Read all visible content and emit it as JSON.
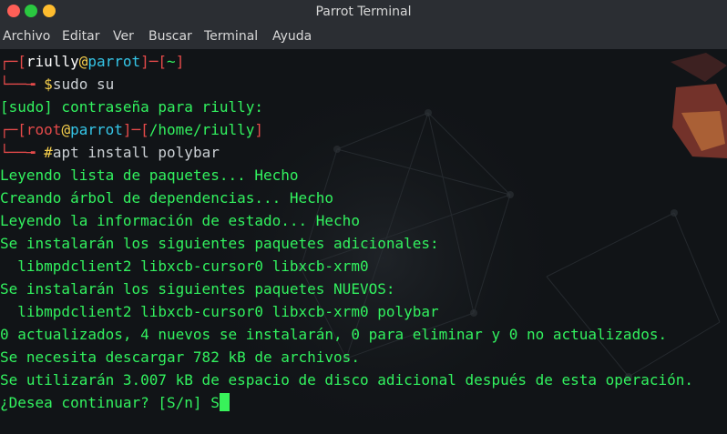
{
  "window": {
    "title": "Parrot Terminal"
  },
  "menu": [
    "Archivo",
    "Editar",
    "Ver",
    "Buscar",
    "Terminal",
    "Ayuda"
  ],
  "terminal": {
    "prompt1": {
      "box_open": "┌─[",
      "user": "riully",
      "at": "@",
      "host": "parrot",
      "sep": "]─[",
      "path": "~",
      "box_close": "]",
      "cmd_prefix": "└──╼ ",
      "dollar": "$",
      "command": "sudo su"
    },
    "sudo_prompt": "[sudo] contraseña para riully:",
    "prompt2": {
      "box_open": "┌─[",
      "user": "root",
      "at": "@",
      "host": "parrot",
      "sep": "]─[",
      "path": "/home/riully",
      "box_close": "]",
      "cmd_prefix": "└──╼ ",
      "hash": "#",
      "command": "apt install polybar"
    },
    "output": [
      "Leyendo lista de paquetes... Hecho",
      "Creando árbol de dependencias... Hecho",
      "Leyendo la información de estado... Hecho",
      "Se instalarán los siguientes paquetes adicionales:",
      "  libmpdclient2 libxcb-cursor0 libxcb-xrm0",
      "Se instalarán los siguientes paquetes NUEVOS:",
      "  libmpdclient2 libxcb-cursor0 libxcb-xrm0 polybar",
      "0 actualizados, 4 nuevos se instalarán, 0 para eliminar y 0 no actualizados.",
      "Se necesita descargar 782 kB de archivos.",
      "Se utilizarán 3.007 kB de espacio de disco adicional después de esta operación."
    ],
    "question": "¿Desea continuar? [S/n] ",
    "answer": "S"
  }
}
